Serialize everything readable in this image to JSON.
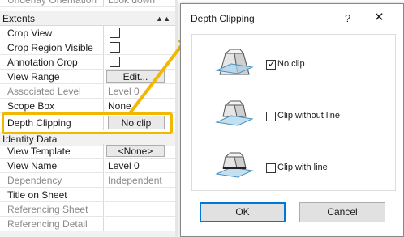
{
  "properties": {
    "top_row": {
      "name": "Underlay Orientation",
      "value": "Look down"
    },
    "extents_header": "Extents",
    "extents": [
      {
        "name": "Crop View",
        "kind": "checkbox",
        "checked": false
      },
      {
        "name": "Crop Region Visible",
        "kind": "checkbox",
        "checked": false
      },
      {
        "name": "Annotation Crop",
        "kind": "checkbox",
        "checked": false
      },
      {
        "name": "View Range",
        "kind": "button",
        "value": "Edit..."
      },
      {
        "name": "Associated Level",
        "kind": "readonly",
        "value": "Level 0"
      },
      {
        "name": "Scope Box",
        "kind": "text",
        "value": "None"
      },
      {
        "name": "Depth Clipping",
        "kind": "button",
        "value": "No clip"
      }
    ],
    "identity_header": "Identity Data",
    "identity": [
      {
        "name": "View Template",
        "kind": "button",
        "value": "<None>"
      },
      {
        "name": "View Name",
        "kind": "text",
        "value": "Level 0"
      },
      {
        "name": "Dependency",
        "kind": "readonly",
        "value": "Independent"
      },
      {
        "name": "Title on Sheet",
        "kind": "text",
        "value": ""
      },
      {
        "name": "Referencing Sheet",
        "kind": "readonly",
        "value": ""
      },
      {
        "name": "Referencing Detail",
        "kind": "readonly",
        "value": ""
      }
    ],
    "collapse_icon": "chevron-up-icon"
  },
  "dialog": {
    "title": "Depth Clipping",
    "help_label": "?",
    "close_label": "✕",
    "options": [
      {
        "label": "No clip",
        "checked": true,
        "icon": "no-clip-icon"
      },
      {
        "label": "Clip without line",
        "checked": false,
        "icon": "clip-without-line-icon"
      },
      {
        "label": "Clip with line",
        "checked": false,
        "icon": "clip-with-line-icon"
      }
    ],
    "ok_label": "OK",
    "cancel_label": "Cancel"
  },
  "colors": {
    "highlight": "#f2b800",
    "ok_border": "#0078d7",
    "icon_fill": "#e6e6e6",
    "icon_plane": "#a9d3ea"
  }
}
